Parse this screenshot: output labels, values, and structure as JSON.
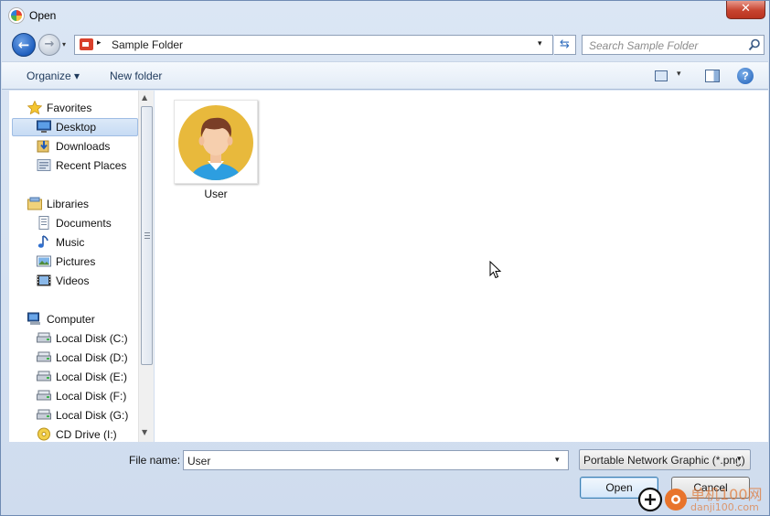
{
  "window": {
    "title": "Open",
    "close_glyph": "✕"
  },
  "nav": {
    "back_glyph": "←",
    "forward_glyph": "→",
    "dropdown_glyph": "▾",
    "breadcrumb_arrow": "▸",
    "address": "Sample Folder",
    "refresh_glyph": "⇆",
    "search_placeholder": "Search Sample Folder"
  },
  "toolbar": {
    "organize_label": "Organize ▾",
    "new_folder_label": "New folder",
    "help_glyph": "?",
    "view_drop_glyph": "▾"
  },
  "sidebar": {
    "favorites": {
      "label": "Favorites",
      "items": [
        "Desktop",
        "Downloads",
        "Recent Places"
      ]
    },
    "libraries": {
      "label": "Libraries",
      "items": [
        "Documents",
        "Music",
        "Pictures",
        "Videos"
      ]
    },
    "computer": {
      "label": "Computer",
      "items": [
        "Local Disk (C:)",
        "Local Disk (D:)",
        "Local Disk (E:)",
        "Local Disk (F:)",
        "Local Disk (G:)",
        "CD Drive (I:)"
      ]
    },
    "selected": "Desktop",
    "scroll_up_glyph": "▲",
    "scroll_down_glyph": "▼"
  },
  "files": [
    {
      "name": "User",
      "type": "avatar-image"
    }
  ],
  "bottom": {
    "file_name_label": "File name:",
    "file_name_value": "User",
    "file_name_drop_glyph": "▾",
    "file_type_value": "Portable Network Graphic (*.png)",
    "file_type_drop_glyph": "▾",
    "open_label": "Open",
    "cancel_label": "Cancel"
  },
  "watermark": {
    "text": "单机100网",
    "sub": "danji100.com"
  },
  "colors": {
    "accent": "#1f5fbf",
    "close": "#c7432f",
    "avatar_bg": "#e8b93c",
    "shirt": "#2d9ee0"
  }
}
